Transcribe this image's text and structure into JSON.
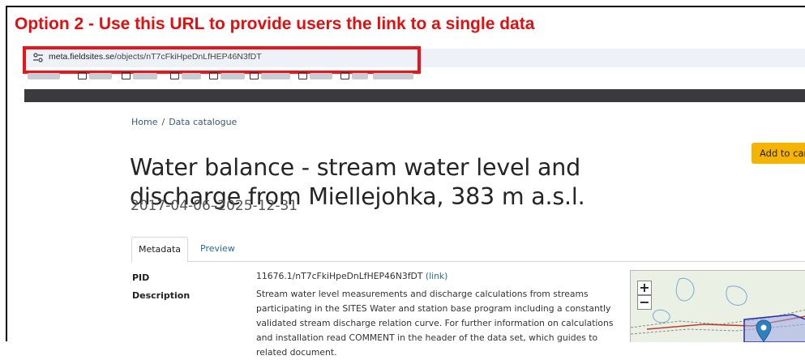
{
  "annotation": {
    "text": "Option 2 - Use this URL to provide users the link to a single data"
  },
  "browser": {
    "url_host": "meta.fieldsites.se",
    "url_path": "/objects/nT7cFkiHpeDnLfHEP46N3fDT"
  },
  "breadcrumb": {
    "home": "Home",
    "separator": "/",
    "current": "Data catalogue"
  },
  "page": {
    "title": "Water balance - stream water level and discharge from Miellejohka, 383 m a.s.l.",
    "date_range": "2017-04-06–2025-12-31",
    "add_to_cart": "Add to cart"
  },
  "tabs": {
    "metadata": "Metadata",
    "preview": "Preview"
  },
  "metadata": {
    "pid_label": "PID",
    "pid_value": "11676.1/nT7cFkiHpeDnLfHEP46N3fDT",
    "pid_link": "(link)",
    "description_label": "Description",
    "description_value": "Stream water level measurements and discharge calculations from streams participating in the SITES Water and station base program including a constantly validated stream discharge relation curve. For further information on calculations and installation read COMMENT in the header of the data set, which guides to related document."
  },
  "map": {
    "zoom_in": "+",
    "zoom_out": "−"
  },
  "colors": {
    "annotation": "#e01010",
    "highlight_box": "#e8161a",
    "cart_button": "#f5b400",
    "nav_bar": "#3b3b3f",
    "link": "#2a6a9a"
  },
  "icons": [
    "site-settings-icon",
    "folder-icon",
    "map-marker-icon"
  ]
}
